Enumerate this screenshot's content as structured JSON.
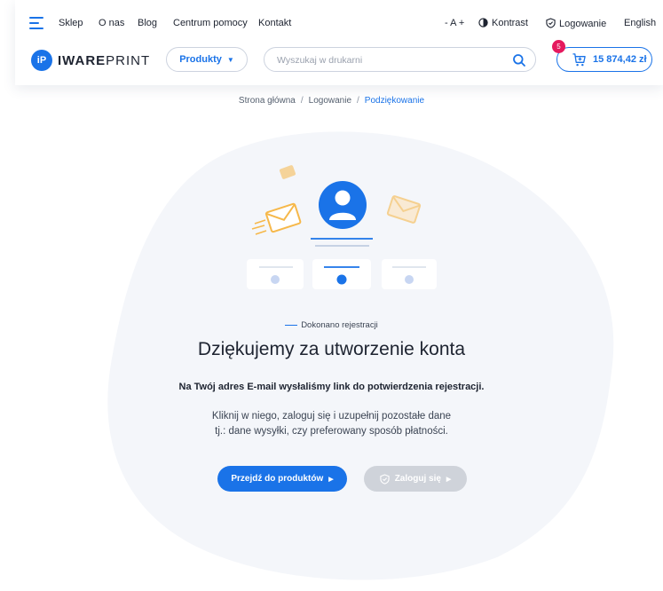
{
  "topnav": {
    "items": [
      "Sklep",
      "O nas",
      "Blog",
      "Centrum pomocy",
      "Kontakt"
    ]
  },
  "topright": {
    "font_size": "- A +",
    "contrast": "Kontrast",
    "login": "Logowanie",
    "language": "English"
  },
  "logo": {
    "badge": "iP",
    "text_bold": "IWARE",
    "text_light": "PRINT"
  },
  "header": {
    "products_label": "Produkty",
    "search_placeholder": "Wyszukaj w drukarni",
    "cart_badge": "5",
    "cart_total": "15 874,42 zł"
  },
  "breadcrumb": [
    "Strona główna",
    "Logowanie",
    "Podziękowanie"
  ],
  "main": {
    "status": "Dokonano rejestracji",
    "title": "Dziękujemy za utworzenie konta",
    "subtitle": "Na Twój adres E-mail wysłaliśmy link do potwierdzenia rejestracji.",
    "desc_line1": "Kliknij w niego, zaloguj się i uzupełnij pozostałe dane",
    "desc_line2": "tj.: dane wysyłki, czy preferowany sposób płatności.",
    "primary_button": "Przejdź do produktów",
    "secondary_button": "Zaloguj się"
  },
  "colors": {
    "accent": "#1a73e8",
    "badge": "#e5195e",
    "envelope": "#f6b84a",
    "disabled_button": "#cfd3da"
  }
}
